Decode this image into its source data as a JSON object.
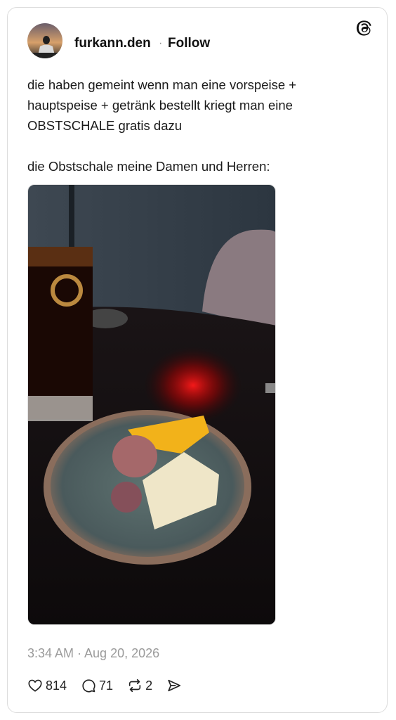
{
  "post": {
    "username": "furkann.den",
    "separator": "·",
    "follow_label": "Follow",
    "text_paragraph_1": "die haben gemeint wenn man eine vorspeise +\nhauptspeise + getränk bestellt kriegt man eine\nOBSTSCHALE gratis dazu",
    "text_paragraph_2": "die Obstschale meine Damen und Herren:",
    "timestamp": "3:34 AM · Aug 20, 2026"
  },
  "actions": {
    "likes": "814",
    "replies": "71",
    "reposts": "2"
  },
  "icons": {
    "brand": "threads-logo-icon",
    "like": "heart-icon",
    "reply": "speech-bubble-icon",
    "repost": "repost-icon",
    "share": "send-icon"
  }
}
